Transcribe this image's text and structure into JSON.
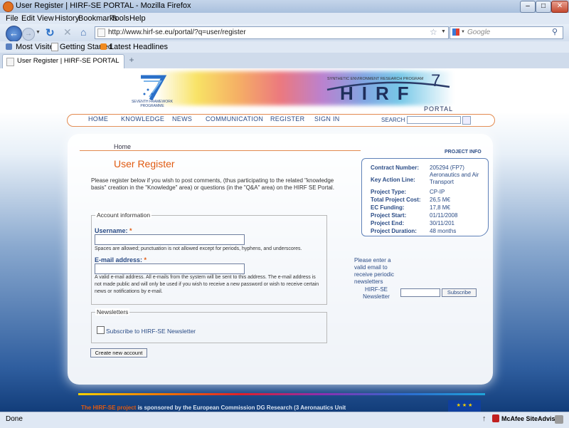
{
  "window": {
    "title": "User Register | HIRF-SE PORTAL - Mozilla Firefox"
  },
  "menubar": [
    "File",
    "Edit",
    "View",
    "History",
    "Bookmarks",
    "Tools",
    "Help"
  ],
  "nav": {
    "url": "http://www.hirf-se.eu/portal/?q=user/register",
    "search_placeholder": "Google"
  },
  "bookmarks": [
    "Most Visited",
    "Getting Started",
    "Latest Headlines"
  ],
  "tab": {
    "label": "User Register | HIRF-SE PORTAL",
    "new_tab": "+"
  },
  "header": {
    "fp7_text": "SEVENTH FRAMEWORK PROGRAMME",
    "program": "SYNTHETIC ENVIRONMENT RESEARCH PROGRAM",
    "logo": "HIRF",
    "portal": "PORTAL"
  },
  "site_nav": [
    "HOME",
    "KNOWLEDGE",
    "NEWS",
    "COMMUNICATION",
    "REGISTER",
    "SIGN IN"
  ],
  "site_search_label": "SEARCH",
  "breadcrumb": "Home",
  "page_title": "User Register",
  "intro": "Please register below if you wish to post comments, (thus participating to the related \"knowledge basis\" creation in the \"Knowledge\" area) or questions (in the \"Q&A\" area) on the HIRF SE Portal.",
  "account": {
    "legend": "Account information",
    "username_label": "Username:",
    "username_help": "Spaces are allowed; punctuation is not allowed except for periods, hyphens, and underscores.",
    "email_label": "E-mail address:",
    "email_help": "A valid e-mail address. All e-mails from the system will be sent to this address. The e-mail address is not made public and will only be used if you wish to receive a new password or wish to receive certain news or notifications by e-mail.",
    "required_mark": "*"
  },
  "newsletters": {
    "legend": "Newsletters",
    "checkbox_label": "Subscribe to HIRF-SE Newsletter"
  },
  "create_button": "Create new account",
  "project_info": {
    "title": "PROJECT INFO",
    "rows": [
      {
        "k": "Contract Number:",
        "v": "205294 (FP7)"
      },
      {
        "k": "Key Action Line:",
        "v": "Aeronautics and Air Transport"
      },
      {
        "k": "Project Type:",
        "v": "CP-IP"
      },
      {
        "k": "Total Project Cost:",
        "v": "26,5 M€"
      },
      {
        "k": "EC Funding:",
        "v": "17,8 M€"
      },
      {
        "k": "Project Start:",
        "v": "01/11/2008"
      },
      {
        "k": "Project End:",
        "v": "30/11/201"
      },
      {
        "k": "Project Duration:",
        "v": "48 months"
      }
    ]
  },
  "newsletter_side": {
    "text": "Please enter a valid email to receive periodic newsletters",
    "label": "HIRF-SE Newsletter",
    "button": "Subscribe"
  },
  "footer": {
    "highlight": "The HIRF-SE project",
    "rest": " is sponsored by the European Commission DG Research (3 Aeronautics Unit"
  },
  "status": {
    "text": "Done",
    "addon": "McAfee SiteAdvisor"
  },
  "colors": {
    "accent_orange": "#e05a10",
    "nav_blue": "#2b4c86",
    "menu_border": "#e38a4f"
  }
}
